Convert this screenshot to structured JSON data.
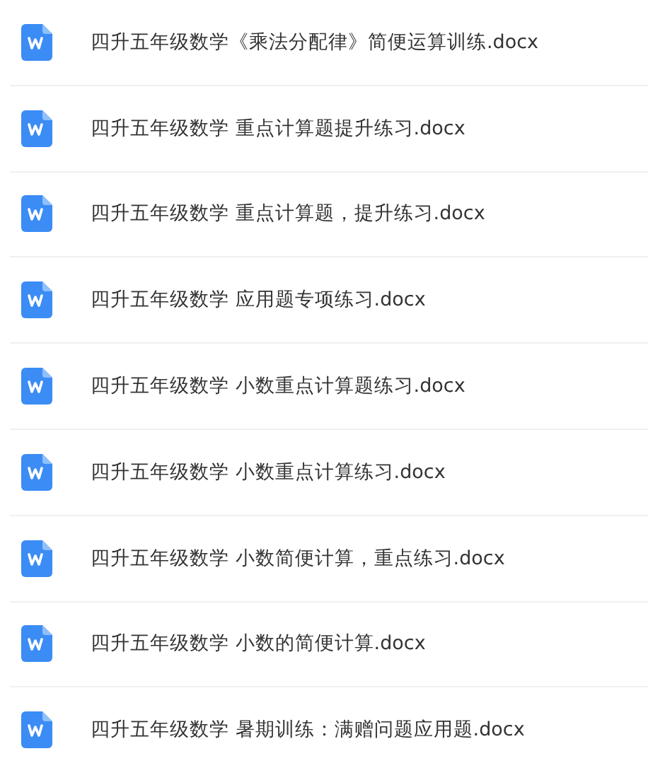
{
  "files": [
    {
      "name": "四升五年级数学《乘法分配律》简便运算训练.docx"
    },
    {
      "name": "四升五年级数学 重点计算题提升练习.docx"
    },
    {
      "name": "四升五年级数学 重点计算题，提升练习.docx"
    },
    {
      "name": "四升五年级数学 应用题专项练习.docx"
    },
    {
      "name": "四升五年级数学 小数重点计算题练习.docx"
    },
    {
      "name": "四升五年级数学 小数重点计算练习.docx"
    },
    {
      "name": "四升五年级数学 小数简便计算，重点练习.docx"
    },
    {
      "name": "四升五年级数学 小数的简便计算.docx"
    },
    {
      "name": "四升五年级数学 暑期训练：满赠问题应用题.docx"
    }
  ]
}
